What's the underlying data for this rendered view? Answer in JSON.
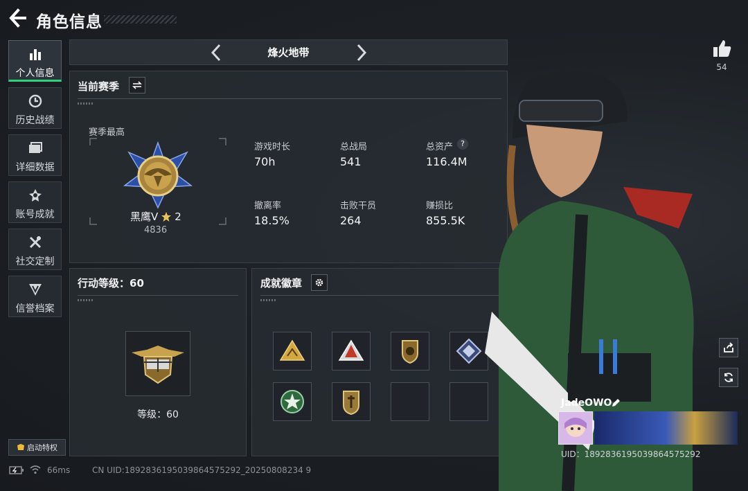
{
  "header": {
    "title": "角色信息"
  },
  "sidebar": {
    "items": [
      {
        "label": "个人信息",
        "icon": "bar-chart-icon",
        "active": true
      },
      {
        "label": "历史战绩",
        "icon": "clock-icon"
      },
      {
        "label": "详细数据",
        "icon": "folder-icon"
      },
      {
        "label": "账号成就",
        "icon": "badge-icon"
      },
      {
        "label": "社交定制",
        "icon": "tools-icon"
      },
      {
        "label": "信誉档案",
        "icon": "shield-icon"
      }
    ],
    "privilege_button": "启动特权"
  },
  "mode": {
    "name": "烽火地带"
  },
  "season": {
    "title": "当前赛季",
    "best_label": "赛季最高",
    "rank_name": "黑鹰V",
    "rank_stars": "2",
    "rank_score": "4836",
    "stats": [
      {
        "label": "游戏时长",
        "value": "70h"
      },
      {
        "label": "总战局",
        "value": "541"
      },
      {
        "label": "总资产",
        "value": "116.4M",
        "has_help": true
      },
      {
        "label": "撤离率",
        "value": "18.5%"
      },
      {
        "label": "击败干员",
        "value": "264"
      },
      {
        "label": "赚损比",
        "value": "855.5K"
      }
    ]
  },
  "action_level": {
    "title": "行动等级：60",
    "level_text": "等级：60"
  },
  "achievements": {
    "title": "成就徽章",
    "badges": [
      {
        "icon": "gold-triangle-badge-icon",
        "empty": false
      },
      {
        "icon": "red-triangle-badge-icon",
        "empty": false
      },
      {
        "icon": "shield-badge-icon",
        "empty": false
      },
      {
        "icon": "blue-diamond-badge-icon",
        "empty": false
      },
      {
        "icon": "green-star-badge-icon",
        "empty": false
      },
      {
        "icon": "bronze-shield-badge-icon",
        "empty": false
      },
      {
        "icon": "",
        "empty": true
      },
      {
        "icon": "",
        "empty": true
      }
    ]
  },
  "player": {
    "likes": "54",
    "name": "JadeOWO",
    "uid_overlay": "UID：1892836195039864575292"
  },
  "footer": {
    "ping": "66ms",
    "uid": "CN UID:1892836195039864575292_20250808234 9"
  },
  "colors": {
    "accent_green": "#2fd27a",
    "panel": "#262b31",
    "background": "#1b1f24"
  }
}
